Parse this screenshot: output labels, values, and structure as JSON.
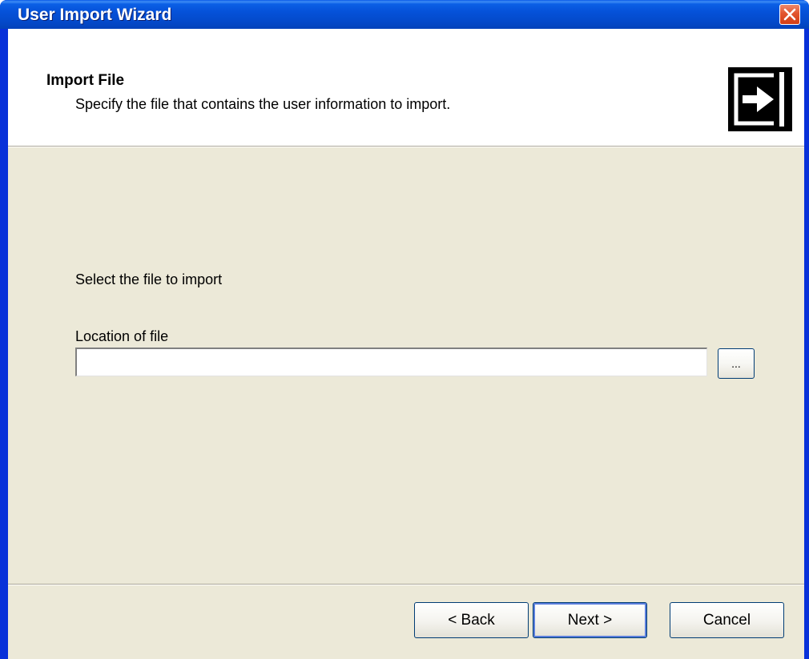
{
  "window": {
    "title": "User Import Wizard"
  },
  "header": {
    "title": "Import File",
    "subtitle": "Specify the file that contains the user information to import.",
    "icon": "import-arrow-icon"
  },
  "body": {
    "prompt": "Select the file to import",
    "location_label": "Location of file",
    "location_value": "",
    "browse_label": "..."
  },
  "buttons": {
    "back": "< Back",
    "next": "Next >",
    "cancel": "Cancel"
  },
  "colors": {
    "titlebar": "#0552d9",
    "close_button": "#e2542d",
    "dialog_background": "#ece9d8",
    "header_background": "#ffffff"
  }
}
